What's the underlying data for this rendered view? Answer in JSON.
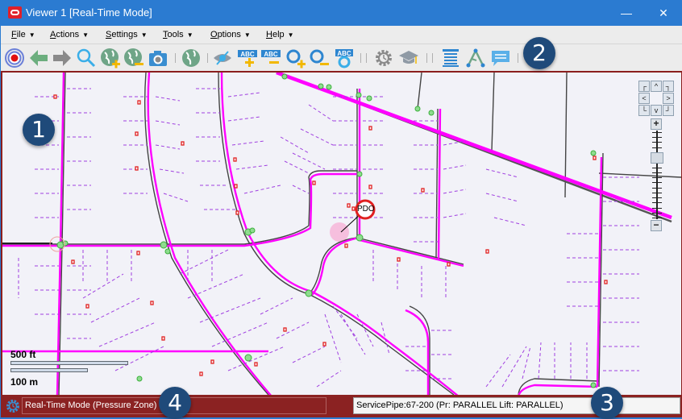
{
  "window": {
    "title": "Viewer 1 [Real-Time Mode]",
    "controls": {
      "minimize": "—",
      "maximize": "☐",
      "close": "✕"
    }
  },
  "menubar": {
    "items": [
      {
        "label": "File",
        "mnemonic": "F"
      },
      {
        "label": "Actions",
        "mnemonic": "A"
      },
      {
        "label": "Settings",
        "mnemonic": "S"
      },
      {
        "label": "Tools",
        "mnemonic": "T"
      },
      {
        "label": "Options",
        "mnemonic": "O"
      },
      {
        "label": "Help",
        "mnemonic": "H"
      }
    ],
    "dropdown_glyph": "▼"
  },
  "toolbar": {
    "buttons": [
      {
        "name": "realtime-target-icon"
      },
      {
        "name": "back-arrow-icon"
      },
      {
        "name": "forward-arrow-icon"
      },
      {
        "name": "search-icon"
      },
      {
        "name": "globe-add-icon"
      },
      {
        "name": "globe-remove-icon"
      },
      {
        "name": "camera-icon"
      },
      {
        "name": "globe-icon"
      },
      {
        "name": "visibility-toggle-icon"
      },
      {
        "name": "label-add-icon"
      },
      {
        "name": "label-remove-icon"
      },
      {
        "name": "zoom-in-icon"
      },
      {
        "name": "zoom-out-icon"
      },
      {
        "name": "label-refresh-icon"
      },
      {
        "name": "settings-gear-icon"
      },
      {
        "name": "graduation-cap-icon"
      },
      {
        "name": "list-icon"
      },
      {
        "name": "network-trace-icon"
      },
      {
        "name": "comment-icon"
      }
    ],
    "abc_text": "ABC"
  },
  "map": {
    "scale": {
      "feet": "500 ft",
      "meters": "100 m"
    },
    "marker_label": "PDO",
    "nav": {
      "up": "^",
      "down": "v",
      "left": "<",
      "right": ">",
      "zoom_in": "+",
      "zoom_out": "−"
    },
    "zoom_level_fraction": 0.3,
    "colors": {
      "main_pipe": "#ff00ff",
      "service_pipe": "#9b30ff",
      "road": "#444444",
      "valve": "#e02020",
      "node": "#3bb03b"
    }
  },
  "statusbar": {
    "mode": "Real-Time Mode (Pressure Zone)",
    "selection": "ServicePipe:67-200 (Pr: PARALLEL Lift: PARALLEL)"
  },
  "callouts": [
    "1",
    "2",
    "3",
    "4"
  ]
}
